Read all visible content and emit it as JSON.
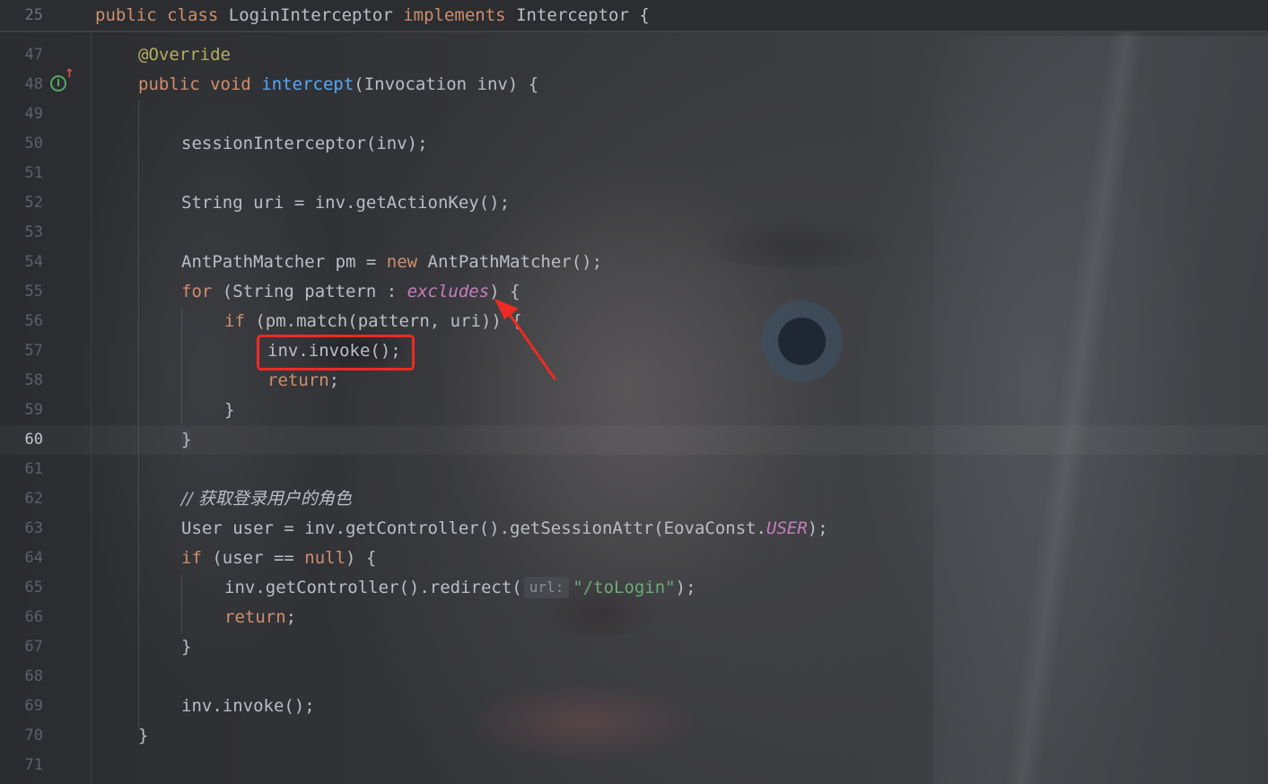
{
  "sticky": {
    "line_number": "25",
    "tokens": {
      "public": "public",
      "class": "class",
      "class_name": "LoginInterceptor",
      "implements": "implements",
      "iface": "Interceptor {"
    }
  },
  "gutter": {
    "implements_icon": "implementing-method-icon",
    "implements_icon_letter": "I",
    "implements_arrow": "↑"
  },
  "lines": {
    "l47": "47",
    "l48": "48",
    "l49": "49",
    "l50": "50",
    "l51": "51",
    "l52": "52",
    "l53": "53",
    "l54": "54",
    "l55": "55",
    "l56": "56",
    "l57": "57",
    "l58": "58",
    "l59": "59",
    "l60": "60",
    "l61": "61",
    "l62": "62",
    "l63": "63",
    "l64": "64",
    "l65": "65",
    "l66": "66",
    "l67": "67",
    "l68": "68",
    "l69": "69",
    "l70": "70",
    "l71": "71"
  },
  "code": {
    "override": "@Override",
    "public": "public",
    "void": "void",
    "intercept": "intercept",
    "intercept_params": "(Invocation inv) {",
    "session_call": "sessionInterceptor(inv);",
    "uri_decl": "String uri = inv.getActionKey();",
    "matcher_decl_a": "AntPathMatcher pm = ",
    "new_kw": "new",
    "matcher_decl_b": " AntPathMatcher();",
    "for_kw": "for",
    "for_mid": " (String pattern : ",
    "excludes": "excludes",
    "for_end": ") ",
    "open_brace": "{",
    "if_kw": "if",
    "if_match": " (pm.match(pattern, uri)) {",
    "invoke_inner": "inv.invoke();",
    "return_kw": "return",
    "semicolon": ";",
    "close_brace": "}",
    "comment": "// 获取登录用户的角色",
    "user_decl": "User user = inv.getController().getSessionAttr(EovaConst.",
    "user_const": "USER",
    "user_end": ");",
    "if_user_a": " (user == ",
    "null_kw": "null",
    "if_user_b": ") {",
    "redirect_a": "inv.getController().redirect(",
    "redirect_hint": "url:",
    "redirect_str": "\"/toLogin\"",
    "redirect_end": ");",
    "invoke_final": "inv.invoke();"
  },
  "annotations": {
    "box_color": "#ee2a24",
    "arrow_color": "#ee2a24"
  },
  "colors": {
    "keyword": "#cf8e6d",
    "function": "#56a8f5",
    "annotation": "#b3ae60",
    "field": "#c77dbb",
    "string": "#6aab73",
    "comment": "#7a7e85",
    "text": "#bcbec4"
  }
}
